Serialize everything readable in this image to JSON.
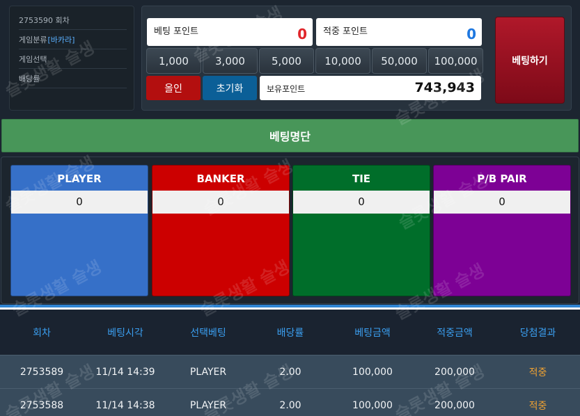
{
  "info": {
    "round": "2753590 회차",
    "category_label": "게임분류",
    "category_value": "[바카라]",
    "game_select": "게임선택",
    "odds": "배당률"
  },
  "betting": {
    "bet_point_label": "베팅 포인트",
    "bet_point_value": "0",
    "win_point_label": "적중 포인트",
    "win_point_value": "0",
    "chips": [
      "1,000",
      "3,000",
      "5,000",
      "10,000",
      "50,000",
      "100,000"
    ],
    "allin_label": "올인",
    "reset_label": "초기화",
    "balance_label": "보유포인트",
    "balance_value": "743,943",
    "bet_button_label": "베팅하기"
  },
  "bet_list_title": "베팅명단",
  "zones": [
    {
      "name": "PLAYER",
      "amount": "0",
      "color": "#3670c8"
    },
    {
      "name": "BANKER",
      "amount": "0",
      "color": "#cc0000"
    },
    {
      "name": "TIE",
      "amount": "0",
      "color": "#006e2a"
    },
    {
      "name": "P/B PAIR",
      "amount": "0",
      "color": "#7d0195"
    }
  ],
  "history": {
    "headers": [
      "회차",
      "베팅시각",
      "선택베팅",
      "배당률",
      "베팅금액",
      "적중금액",
      "당첨결과"
    ],
    "rows": [
      [
        "2753589",
        "11/14 14:39",
        "PLAYER",
        "2.00",
        "100,000",
        "200,000",
        "적중"
      ],
      [
        "2753588",
        "11/14 14:38",
        "PLAYER",
        "2.00",
        "100,000",
        "200,000",
        "적중"
      ]
    ]
  },
  "watermark": "슬롯생활 슬생"
}
